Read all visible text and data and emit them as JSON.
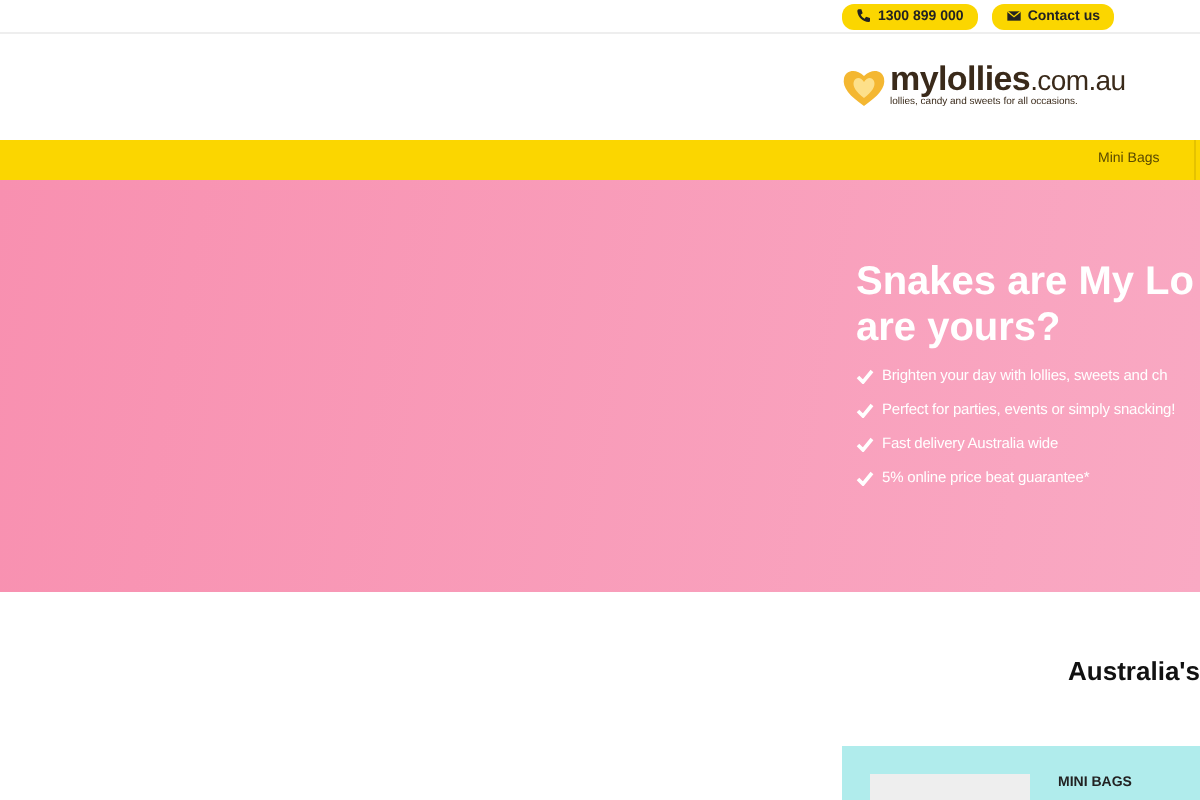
{
  "top_bar": {
    "buttons": [
      {
        "kind": "phone",
        "label": "1300 899 000"
      },
      {
        "kind": "mail",
        "label": "Contact us"
      }
    ]
  },
  "logo": {
    "name": "**mylollies**.com.au",
    "tagline": "lollies, candy and sweets for all occasions."
  },
  "nav": {
    "items": [
      {
        "label": "Mini Bags"
      }
    ]
  },
  "hero": {
    "heading_lines": [
      "Snakes are My Lo",
      "are yours?"
    ],
    "bullets": [
      "Brighten your day with lollies, sweets and ch",
      "Perfect for parties, events or simply snacking!",
      "Fast delivery Australia wide",
      "5% online price beat guarantee*"
    ]
  },
  "section": {
    "heading": "Australia's"
  },
  "product_card": {
    "title": "MINI BAGS"
  }
}
